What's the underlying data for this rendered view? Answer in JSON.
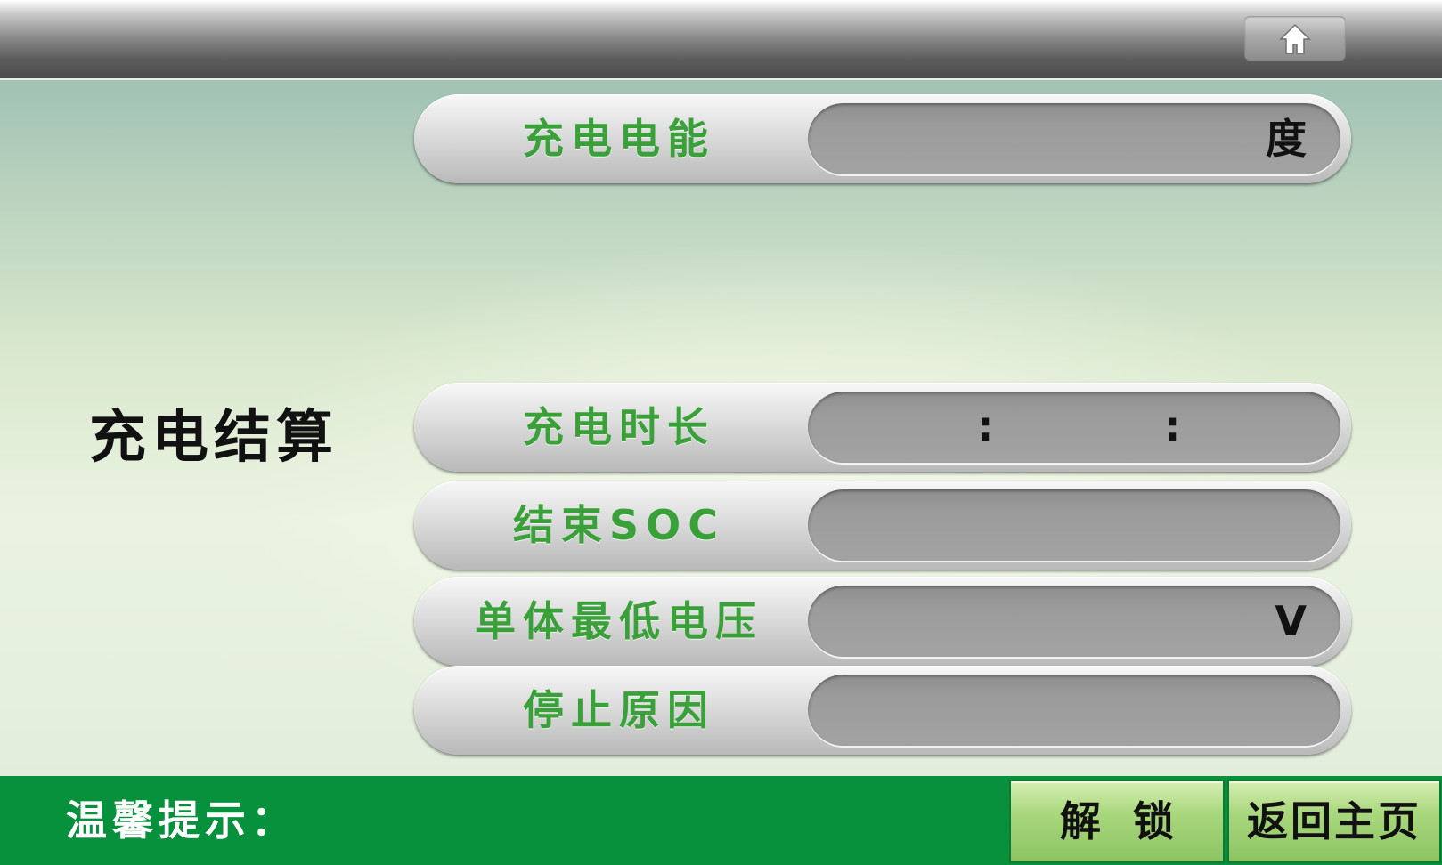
{
  "header": {
    "home_icon": "home-icon"
  },
  "page_title": "充电结算",
  "fields": {
    "energy": {
      "label": "充电电能",
      "value": "",
      "unit": "度"
    },
    "duration": {
      "label": "充电时长",
      "value": "",
      "separators": [
        ":",
        ":"
      ]
    },
    "end_soc": {
      "label": "结束SOC",
      "value": ""
    },
    "min_cell_voltage": {
      "label": "单体最低电压",
      "value": "",
      "unit": "V"
    },
    "stop_reason": {
      "label": "停止原因",
      "value": ""
    }
  },
  "footer": {
    "tip_label": "温馨提示：",
    "unlock_label": "解锁",
    "return_home_label": "返回主页"
  },
  "colors": {
    "label_green": "#3aa03a",
    "footer_green": "#08913c",
    "button_green": "#a9d77d"
  }
}
